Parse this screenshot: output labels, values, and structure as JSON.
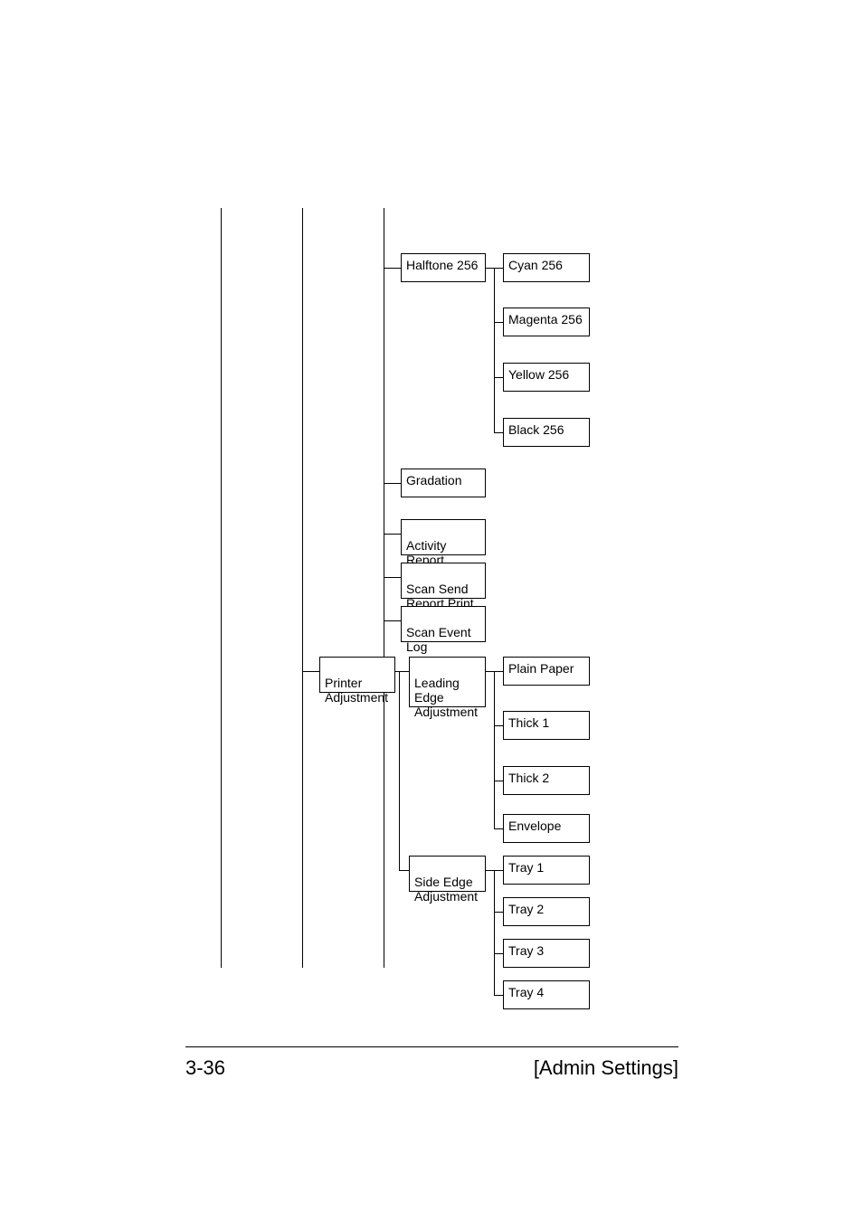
{
  "boxes": {
    "halftone_256": "Halftone 256",
    "cyan_256": "Cyan 256",
    "magenta_256": "Magenta 256",
    "yellow_256": "Yellow 256",
    "black_256": "Black 256",
    "gradation": "Gradation",
    "activity_report": "Activity\nReport",
    "scan_send_report_print": "Scan Send\nReport Print",
    "scan_event_log": "Scan Event\nLog",
    "printer_adjustment": "Printer\nAdjustment",
    "leading_edge_adjustment": "Leading\nEdge\nAdjustment",
    "plain_paper": "Plain Paper",
    "thick_1": "Thick 1",
    "thick_2": "Thick 2",
    "envelope": "Envelope",
    "side_edge_adjustment": "Side Edge\nAdjustment",
    "tray_1": "Tray 1",
    "tray_2": "Tray 2",
    "tray_3": "Tray 3",
    "tray_4": "Tray 4"
  },
  "footer": {
    "page": "3-36",
    "section": "[Admin Settings]"
  }
}
